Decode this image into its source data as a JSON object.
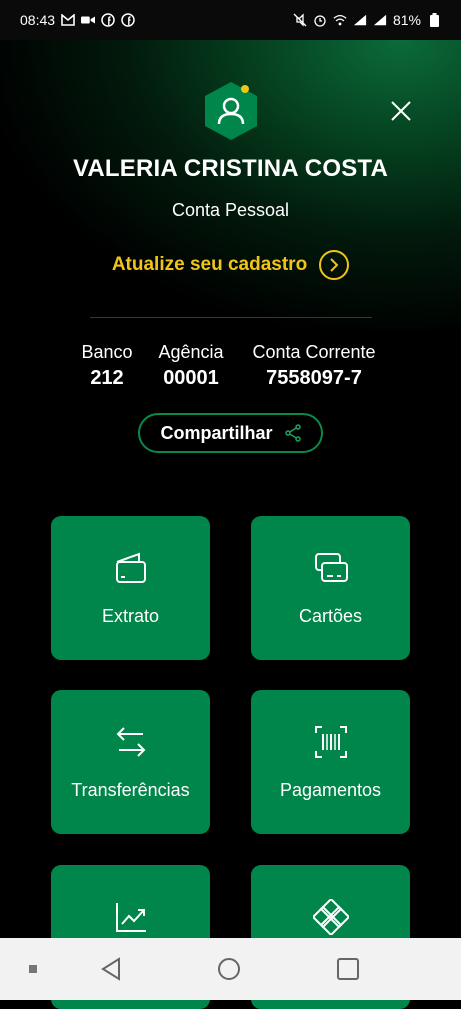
{
  "status_bar": {
    "time": "08:43",
    "battery": "81%",
    "left_icons": [
      "gmail-icon",
      "video-icon",
      "facebook-icon",
      "facebook-icon"
    ],
    "right_icons": [
      "mute-icon",
      "alarm-icon",
      "wifi-icon",
      "signal-icon",
      "signal-icon",
      "battery-icon"
    ]
  },
  "profile": {
    "name": "VALERIA CRISTINA COSTA",
    "account_type": "Conta Pessoal",
    "update_link": "Atualize seu cadastro",
    "notification_dot_color": "#f0c419"
  },
  "account": {
    "bank_label": "Banco",
    "bank_value": "212",
    "agency_label": "Agência",
    "agency_value": "00001",
    "account_label": "Conta Corrente",
    "account_value": "7558097-7"
  },
  "share": {
    "label": "Compartilhar"
  },
  "tiles": [
    {
      "label": "Extrato",
      "icon": "wallet-icon"
    },
    {
      "label": "Cartões",
      "icon": "cards-icon"
    },
    {
      "label": "Transferências",
      "icon": "transfer-arrows-icon"
    },
    {
      "label": "Pagamentos",
      "icon": "barcode-icon"
    },
    {
      "label": "",
      "icon": "chart-growth-icon"
    },
    {
      "label": "",
      "icon": "pix-diamond-icon"
    }
  ],
  "colors": {
    "accent_green": "#00854a",
    "highlight_yellow": "#f0c419",
    "background": "#000000"
  },
  "nav": {
    "icons": [
      "recent-square-icon",
      "back-triangle-icon",
      "home-circle-icon",
      "overview-square-icon"
    ]
  }
}
